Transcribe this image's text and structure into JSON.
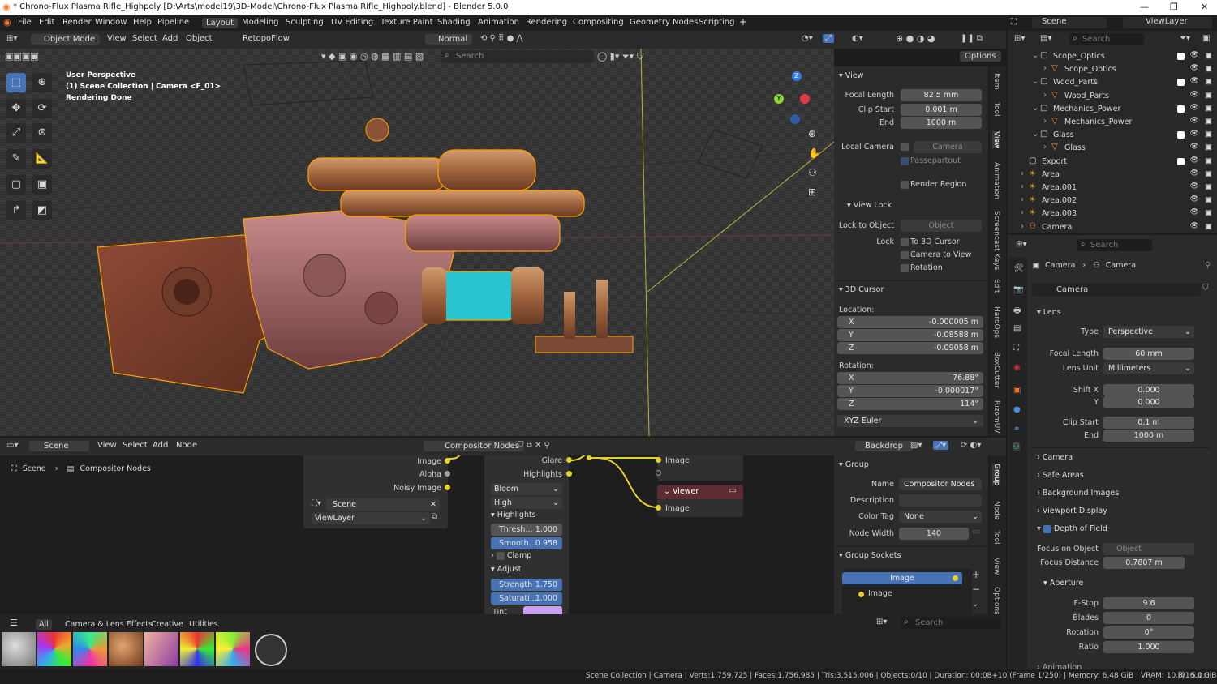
{
  "titlebar": {
    "title": "* Chrono-Flux Plasma Rifle_Highpoly [D:\\Arts\\model19\\3D-Model\\Chrono-Flux Plasma Rifle_Highpoly.blend] - Blender 5.0.0",
    "min": "—",
    "max": "❐",
    "close": "✕"
  },
  "menu": {
    "items": [
      "File",
      "Edit",
      "Render",
      "Window",
      "Help",
      "Pipeline"
    ],
    "workspaces": [
      "Layout",
      "Modeling",
      "Sculpting",
      "UV Editing",
      "Texture Paint",
      "Shading",
      "Animation",
      "Rendering",
      "Compositing",
      "Geometry Nodes",
      "Scripting"
    ],
    "add_ws": "+",
    "scene": "Scene",
    "viewlayer": "ViewLayer"
  },
  "viewport_header": {
    "mode": "Object Mode",
    "menus": [
      "View",
      "Select",
      "Add",
      "Object"
    ],
    "retopo": "RetopoFlow",
    "orientation": "Normal",
    "options": "Options",
    "search_placeholder": "Search"
  },
  "viewport": {
    "line1": "User Perspective",
    "line2": "(1) Scene Collection | Camera <F_01>",
    "line3": "Rendering Done",
    "gizmo": {
      "z": "Z",
      "y": "Y"
    }
  },
  "npanel": {
    "view_title": "View",
    "focal_length_label": "Focal Length",
    "focal_length": "82.5 mm",
    "clip_start_label": "Clip Start",
    "clip_start": "0.001 m",
    "clip_end_label": "End",
    "clip_end": "1000 m",
    "local_camera_label": "Local Camera",
    "local_camera": "Camera",
    "passepartout": "Passepartout",
    "render_region": "Render Region",
    "view_lock_title": "View Lock",
    "lock_to_object_label": "Lock to Object",
    "lock_to_object": "Object",
    "lock_label": "Lock",
    "to_3d_cursor": "To 3D Cursor",
    "camera_to_view": "Camera to View",
    "rotation_lock": "Rotation",
    "cursor_title": "3D Cursor",
    "location_label": "Location:",
    "loc_x": "-0.000005 m",
    "loc_y": "-0.08588 m",
    "loc_z": "-0.09058 m",
    "rotation_label": "Rotation:",
    "rot_x": "76.88°",
    "rot_y": "-0.000017°",
    "rot_z": "114°",
    "euler": "XYZ Euler",
    "x": "X",
    "y": "Y",
    "z": "Z"
  },
  "ntabs": [
    "Item",
    "Tool",
    "View",
    "Animation",
    "Screencast Keys",
    "Edit",
    "HardOps",
    "BoxCutter",
    "RizomUV"
  ],
  "outliner": {
    "search_placeholder": "Search",
    "rows": [
      {
        "name": "Scope_Optics",
        "indent": 1,
        "kind": "collection"
      },
      {
        "name": "Scope_Optics",
        "indent": 2,
        "kind": "mesh"
      },
      {
        "name": "Wood_Parts",
        "indent": 1,
        "kind": "collection"
      },
      {
        "name": "Wood_Parts",
        "indent": 2,
        "kind": "mesh"
      },
      {
        "name": "Mechanics_Power",
        "indent": 1,
        "kind": "collection"
      },
      {
        "name": "Mechanics_Power",
        "indent": 2,
        "kind": "mesh"
      },
      {
        "name": "Glass",
        "indent": 1,
        "kind": "collection"
      },
      {
        "name": "Glass",
        "indent": 2,
        "kind": "mesh"
      },
      {
        "name": "Export",
        "indent": 0,
        "kind": "collection"
      },
      {
        "name": "Area",
        "indent": 0,
        "kind": "light"
      },
      {
        "name": "Area.001",
        "indent": 0,
        "kind": "light"
      },
      {
        "name": "Area.002",
        "indent": 0,
        "kind": "light"
      },
      {
        "name": "Area.003",
        "indent": 0,
        "kind": "light"
      },
      {
        "name": "Camera",
        "indent": 0,
        "kind": "camera"
      }
    ]
  },
  "props": {
    "search_placeholder": "Search",
    "crumb1": "Camera",
    "crumb2": "Camera",
    "data_name": "Camera",
    "lens_title": "Lens",
    "type_label": "Type",
    "type": "Perspective",
    "focal_label": "Focal Length",
    "focal": "60 mm",
    "unit_label": "Lens Unit",
    "unit": "Millimeters",
    "shiftx_label": "Shift X",
    "shiftx": "0.000",
    "shifty_label": "Y",
    "shifty": "0.000",
    "clipstart_label": "Clip Start",
    "clipstart": "0.1 m",
    "clipend_label": "End",
    "clipend": "1000 m",
    "sections": [
      "Camera",
      "Safe Areas",
      "Background Images",
      "Viewport Display"
    ],
    "dof_title": "Depth of Field",
    "focus_obj_label": "Focus on Object",
    "focus_obj": "Object",
    "focus_dist_label": "Focus Distance",
    "focus_dist": "0.7807 m",
    "aperture_title": "Aperture",
    "fstop_label": "F-Stop",
    "fstop": "9.6",
    "blades_label": "Blades",
    "blades": "0",
    "rotation_label": "Rotation",
    "rotation": "0°",
    "ratio_label": "Ratio",
    "ratio": "1.000",
    "animation_title": "Animation"
  },
  "node_header": {
    "scene": "Scene",
    "menus": [
      "View",
      "Select",
      "Add",
      "Node"
    ],
    "tree": "Compositor Nodes",
    "backdrop": "Backdrop"
  },
  "node_editor": {
    "crumb1": "Scene",
    "crumb2": "Compositor Nodes",
    "rl_image": "Image",
    "rl_alpha": "Alpha",
    "rl_noisy": "Noisy Image",
    "rl_scene": "Scene",
    "rl_layer": "ViewLayer",
    "glare_out": "Glare",
    "highlights_out": "Highlights",
    "glare_type": "Bloom",
    "quality": "High",
    "highlights_sec": "Highlights",
    "thresh_label": "Thresh...",
    "thresh": "1.000",
    "smooth_label": "Smooth...",
    "smooth": "0.958",
    "clamp": "Clamp",
    "adjust_sec": "Adjust",
    "strength_label": "Strength",
    "strength": "1.750",
    "sat_label": "Saturati...",
    "sat": "1.000",
    "tint": "Tint",
    "tint_color": "#c8a2f0",
    "group_out_image": "Image",
    "viewer_title": "Viewer",
    "viewer_image": "Image"
  },
  "node_npanel": {
    "group_title": "Group",
    "name_label": "Name",
    "name": "Compositor Nodes",
    "desc_label": "Description",
    "color_tag_label": "Color Tag",
    "color_tag": "None",
    "node_width_label": "Node Width",
    "node_width": "140",
    "sockets_title": "Group Sockets",
    "socket1": "Image",
    "socket2": "Image"
  },
  "node_tabs": [
    "Group",
    "Node",
    "Tool",
    "View",
    "Options"
  ],
  "assets": {
    "tabs": [
      "All",
      "Camera & Lens Effects",
      "Creative",
      "Utilities"
    ],
    "search_placeholder": "Search"
  },
  "status": {
    "text": "Scene Collection | Camera | Verts:1,759,725 | Faces:1,756,985 | Tris:3,515,006 | Objects:0/10 | Duration: 00:08+10 (Frame 1/250) | Memory: 6.48 GiB | VRAM: 10.8/16.0 GiB",
    "version": "5.0.0"
  },
  "colors": {
    "accent": "#4772b3",
    "socket": "#e6d22a",
    "selection_outline": "#ffa000"
  }
}
